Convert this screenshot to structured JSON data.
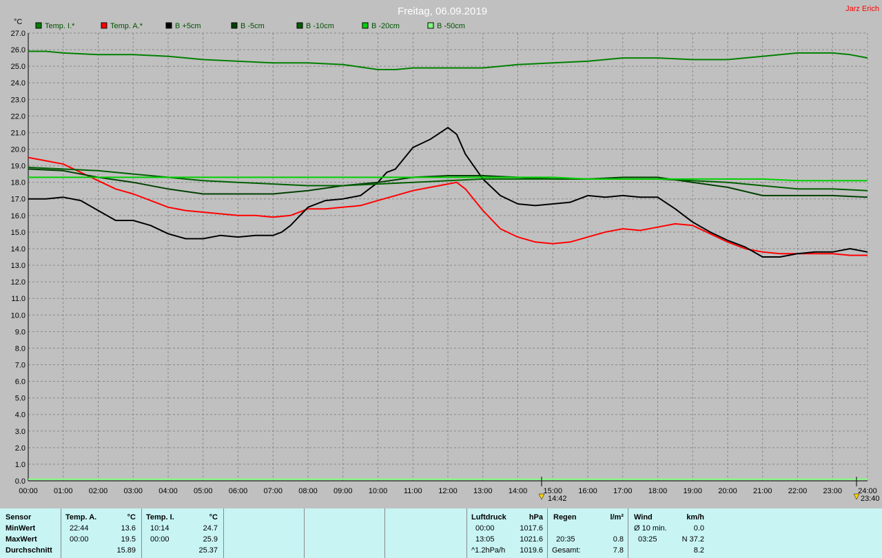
{
  "title": "Freitag, 06.09.2019",
  "author": "Jarz Erich",
  "y_unit": "°C",
  "marker_labels": [
    "14:42",
    "23:40"
  ],
  "colors": {
    "temp_innen": "#008000",
    "temp_aussen": "#ff0000",
    "b5": "#000000",
    "b_5": "#004000",
    "b_10": "#006000",
    "b_20": "#00d000",
    "b_50": "#80ff80",
    "title": "#ffffff",
    "author": "#ff0000"
  },
  "chart_data": {
    "type": "line",
    "title": "Freitag, 06.09.2019",
    "ylabel": "°C",
    "xlabel": "",
    "ylim": [
      0,
      27
    ],
    "xlim": [
      0,
      24
    ],
    "grid": true,
    "legend_position": "top",
    "x_ticks": [
      "00:00",
      "01:00",
      "02:00",
      "03:00",
      "04:00",
      "05:00",
      "06:00",
      "07:00",
      "08:00",
      "09:00",
      "10:00",
      "11:00",
      "12:00",
      "13:00",
      "14:00",
      "15:00",
      "16:00",
      "17:00",
      "18:00",
      "19:00",
      "20:00",
      "21:00",
      "22:00",
      "23:00",
      "24:00"
    ],
    "y_ticks": [
      "0.0",
      "1.0",
      "2.0",
      "3.0",
      "4.0",
      "5.0",
      "6.0",
      "7.0",
      "8.0",
      "9.0",
      "10.0",
      "11.0",
      "12.0",
      "13.0",
      "14.0",
      "15.0",
      "16.0",
      "17.0",
      "18.0",
      "19.0",
      "20.0",
      "21.0",
      "22.0",
      "23.0",
      "24.0",
      "25.0",
      "26.0",
      "27.0"
    ],
    "series": [
      {
        "name": "Temp. I.*",
        "color": "#008000",
        "x": [
          0,
          0.5,
          1,
          2,
          3,
          4,
          5,
          6,
          7,
          8,
          9,
          10,
          10.5,
          11,
          12,
          13,
          14,
          15,
          16,
          17,
          18,
          19,
          20,
          21,
          22,
          23,
          23.5,
          24
        ],
        "y": [
          25.9,
          25.9,
          25.8,
          25.7,
          25.7,
          25.6,
          25.4,
          25.3,
          25.2,
          25.2,
          25.1,
          24.8,
          24.8,
          24.9,
          24.9,
          24.9,
          25.1,
          25.2,
          25.3,
          25.5,
          25.5,
          25.4,
          25.4,
          25.6,
          25.8,
          25.8,
          25.7,
          25.5
        ]
      },
      {
        "name": "Temp. A.*",
        "color": "#ff0000",
        "x": [
          0,
          0.5,
          1,
          1.5,
          2,
          2.5,
          3,
          3.5,
          4,
          4.5,
          5,
          5.5,
          6,
          6.5,
          7,
          7.5,
          8,
          8.5,
          9,
          9.5,
          10,
          10.5,
          11,
          11.5,
          12,
          12.25,
          12.5,
          13,
          13.5,
          14,
          14.5,
          15,
          15.5,
          16,
          16.5,
          17,
          17.5,
          18,
          18.5,
          19,
          19.5,
          20,
          20.5,
          21,
          21.5,
          22,
          22.5,
          23,
          23.5,
          24
        ],
        "y": [
          19.5,
          19.3,
          19.1,
          18.6,
          18.1,
          17.6,
          17.3,
          16.9,
          16.5,
          16.3,
          16.2,
          16.1,
          16.0,
          16.0,
          15.9,
          16.0,
          16.4,
          16.4,
          16.5,
          16.6,
          16.9,
          17.2,
          17.5,
          17.7,
          17.9,
          18.0,
          17.6,
          16.3,
          15.2,
          14.7,
          14.4,
          14.3,
          14.4,
          14.7,
          15.0,
          15.2,
          15.1,
          15.3,
          15.5,
          15.4,
          14.9,
          14.4,
          14.0,
          13.8,
          13.7,
          13.7,
          13.7,
          13.7,
          13.6,
          13.6
        ]
      },
      {
        "name": "B +5cm",
        "color": "#000000",
        "x": [
          0,
          0.5,
          1,
          1.5,
          2,
          2.5,
          3,
          3.5,
          4,
          4.5,
          5,
          5.5,
          6,
          6.5,
          7,
          7.25,
          7.5,
          8,
          8.5,
          9,
          9.5,
          10,
          10.25,
          10.5,
          11,
          11.5,
          12,
          12.25,
          12.5,
          13,
          13.5,
          14,
          14.5,
          15,
          15.5,
          16,
          16.5,
          17,
          17.5,
          18,
          18.5,
          19,
          19.5,
          20,
          20.5,
          21,
          21.5,
          22,
          22.5,
          23,
          23.5,
          24
        ],
        "y": [
          17.0,
          17.0,
          17.1,
          16.9,
          16.3,
          15.7,
          15.7,
          15.4,
          14.9,
          14.6,
          14.6,
          14.8,
          14.7,
          14.8,
          14.8,
          15.0,
          15.4,
          16.5,
          16.9,
          17.0,
          17.2,
          18.0,
          18.6,
          18.8,
          20.1,
          20.6,
          21.3,
          20.9,
          19.7,
          18.2,
          17.2,
          16.7,
          16.6,
          16.7,
          16.8,
          17.2,
          17.1,
          17.2,
          17.1,
          17.1,
          16.4,
          15.6,
          15.0,
          14.5,
          14.1,
          13.5,
          13.5,
          13.7,
          13.8,
          13.8,
          14.0,
          13.8
        ]
      },
      {
        "name": "B -5cm",
        "color": "#004000",
        "x": [
          0,
          1,
          2,
          3,
          4,
          5,
          6,
          7,
          8,
          9,
          10,
          11,
          12,
          13,
          14,
          15,
          16,
          17,
          18,
          19,
          20,
          21,
          22,
          23,
          24
        ],
        "y": [
          18.8,
          18.7,
          18.3,
          18.0,
          17.6,
          17.3,
          17.3,
          17.3,
          17.5,
          17.8,
          18.0,
          18.3,
          18.4,
          18.4,
          18.3,
          18.2,
          18.2,
          18.3,
          18.3,
          18.0,
          17.7,
          17.2,
          17.2,
          17.2,
          17.1
        ]
      },
      {
        "name": "B -10cm",
        "color": "#006000",
        "x": [
          0,
          1,
          2,
          3,
          4,
          5,
          6,
          7,
          8,
          9,
          10,
          11,
          12,
          13,
          14,
          15,
          16,
          17,
          18,
          19,
          20,
          21,
          22,
          23,
          24
        ],
        "y": [
          18.9,
          18.8,
          18.7,
          18.5,
          18.3,
          18.1,
          18.0,
          17.9,
          17.8,
          17.8,
          17.9,
          18.0,
          18.1,
          18.2,
          18.2,
          18.2,
          18.2,
          18.2,
          18.2,
          18.1,
          18.0,
          17.8,
          17.6,
          17.6,
          17.5
        ]
      },
      {
        "name": "B -20cm",
        "color": "#00d000",
        "x": [
          0,
          1,
          2,
          3,
          4,
          5,
          6,
          7,
          8,
          9,
          10,
          11,
          12,
          13,
          14,
          15,
          16,
          17,
          18,
          19,
          20,
          21,
          22,
          23,
          24
        ],
        "y": [
          18.3,
          18.3,
          18.3,
          18.3,
          18.3,
          18.3,
          18.3,
          18.3,
          18.3,
          18.3,
          18.3,
          18.3,
          18.3,
          18.3,
          18.3,
          18.3,
          18.2,
          18.2,
          18.2,
          18.2,
          18.2,
          18.2,
          18.1,
          18.1,
          18.1
        ]
      },
      {
        "name": "B -50cm",
        "color": "#80ff80",
        "x": [
          0,
          24
        ],
        "y": [
          0.1,
          0.1
        ]
      }
    ]
  },
  "stats": {
    "row_labels": [
      "Sensor",
      "MinWert",
      "MaxWert",
      "Durchschnitt"
    ],
    "temp_a": {
      "header": "Temp. A.",
      "unit": "°C",
      "min_time": "22:44",
      "min": "13.6",
      "max_time": "00:00",
      "max": "19.5",
      "avg": "15.89"
    },
    "temp_i": {
      "header": "Temp. I.",
      "unit": "°C",
      "min_time": "10:14",
      "min": "24.7",
      "max_time": "00:00",
      "max": "25.9",
      "avg": "25.37"
    },
    "luftdruck": {
      "header": "Luftdruck",
      "unit": "hPa",
      "min_time": "00:00",
      "min": "1017.6",
      "max_time": "13:05",
      "max": "1021.6",
      "trend": "^1.2hPa/h",
      "current": "1019.6"
    },
    "regen": {
      "header": "Regen",
      "unit": "l/m²",
      "max_time": "20:35",
      "max": "0.8",
      "total_label": "Gesamt:",
      "total": "7.8"
    },
    "wind": {
      "header": "Wind",
      "unit": "km/h",
      "avg_label": "Ø 10 min.",
      "avg": "0.0",
      "max_time": "03:25",
      "max": "N 37.2",
      "current": "8.2"
    }
  }
}
